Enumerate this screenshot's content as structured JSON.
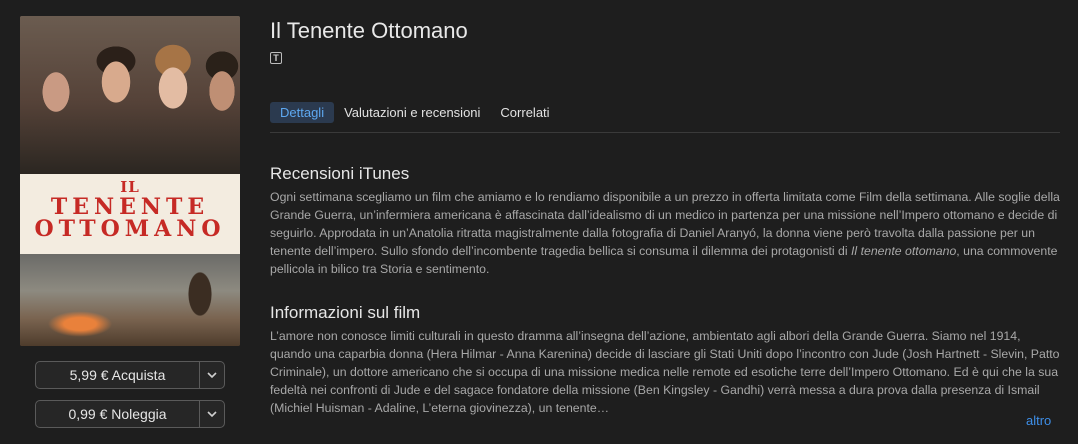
{
  "movie": {
    "title": "Il Tenente Ottomano",
    "rating_badge": "T",
    "poster": {
      "title_line1": "IL",
      "title_line2": "TENENTE",
      "title_line3": "OTTOMANO"
    }
  },
  "purchase": {
    "buy_label": "5,99 € Acquista",
    "rent_label": "0,99 € Noleggia"
  },
  "tabs": [
    {
      "label": "Dettagli",
      "active": true
    },
    {
      "label": "Valutazioni e recensioni",
      "active": false
    },
    {
      "label": "Correlati",
      "active": false
    }
  ],
  "review": {
    "heading": "Recensioni iTunes",
    "text_before_italic": "Ogni settimana scegliamo un film che amiamo e lo rendiamo disponibile a un prezzo in offerta limitata come Film della settimana. Alle soglie della Grande Guerra, un’infermiera americana è affascinata dall’idealismo di un medico in partenza per una missione nell’Impero ottomano e decide di seguirlo. Approdata in un’Anatolia ritratta magistralmente dalla fotografia di Daniel Aranyó, la donna viene però travolta dalla passione per un tenente dell’impero. Sullo sfondo dell’incombente tragedia bellica si consuma il dilemma dei protagonisti di ",
    "italic_title": "Il tenente ottomano",
    "text_after_italic": ", una commovente pellicola in bilico tra Storia e sentimento."
  },
  "info": {
    "heading": "Informazioni sul film",
    "text": "L’amore non conosce limiti culturali in questo dramma all’insegna dell’azione, ambientato agli albori della Grande Guerra. Siamo nel 1914, quando una caparbia donna (Hera Hilmar - Anna Karenina) decide di lasciare gli Stati Uniti dopo l’incontro con Jude (Josh Hartnett - Slevin, Patto Criminale), un dottore americano che si occupa di una missione medica nelle remote ed esotiche terre dell’Impero Ottomano. Ed è qui che la sua fedeltà nei confronti di Jude e del sagace fondatore della missione (Ben Kingsley - Gandhi) verrà messa a dura prova dalla presenza di Ismail (Michiel Huisman - Adaline, L’eterna giovinezza), un tenente…",
    "more_label": "altro"
  },
  "colors": {
    "background": "#1e1e1e",
    "accent": "#3e8fe8",
    "poster_title_red": "#c62a25"
  }
}
